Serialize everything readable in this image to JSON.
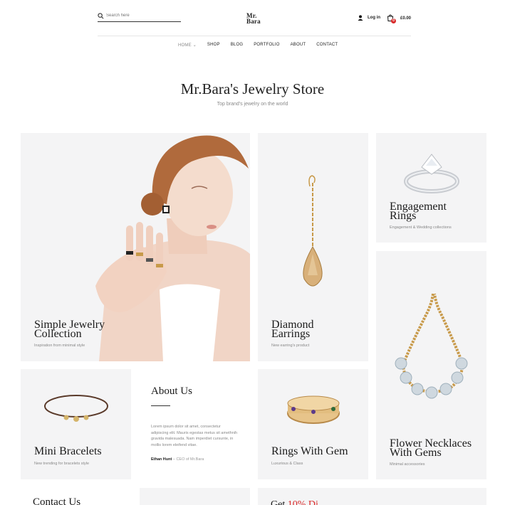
{
  "header": {
    "search_placeholder": "Search here",
    "logo_line1": "Mr.",
    "logo_line2": "Bara",
    "login_label": "Log in",
    "cart_total": "£0.00",
    "cart_count": "0"
  },
  "nav": {
    "items": [
      "HOME",
      "SHOP",
      "BLOG",
      "PORTFOLIO",
      "ABOUT",
      "CONTACT"
    ],
    "home_chevron": "⌄"
  },
  "hero": {
    "title": "Mr.Bara's Jewelry Store",
    "subtitle": "Top brand's jewelry on the world"
  },
  "cards": {
    "simple": {
      "title_line1": "Simple Jewelry",
      "title_line2": "Collection",
      "sub": "Inspiration from minimal style"
    },
    "diamond": {
      "title_line1": "Diamond",
      "title_line2": "Earrings",
      "sub": "New earring's product"
    },
    "engagement": {
      "title_line1": "Engagement",
      "title_line2": "Rings",
      "sub": "Engagement & Wedding collections"
    },
    "bracelets": {
      "title": "Mini Bracelets",
      "sub": "New trending for bracelets style"
    },
    "gem": {
      "title": "Rings With Gem",
      "sub": "Luxurious & Class"
    },
    "necklaces": {
      "title_line1": "Flower Necklaces",
      "title_line2": "With Gems",
      "sub": "Minimal accessories"
    }
  },
  "about": {
    "heading": "About Us",
    "body": "Lorem ipsum dolor sit amet, consectetur adipiscing elit. Mauris egestas metus sit amethnih gravida malesuada. Nam imperdiet cursunte, in mollis lorem eleifend vitae.",
    "author_name": "Ethan Hunt",
    "author_role": " – CEO of Mr.Bara"
  },
  "bottom": {
    "contact": "Contact Us",
    "peek_prefix": "Get ",
    "peek_highlight": "10% Di"
  },
  "colors": {
    "accent": "#d92b2b",
    "card_bg": "#f4f4f5",
    "gold": "#c89a4a"
  }
}
